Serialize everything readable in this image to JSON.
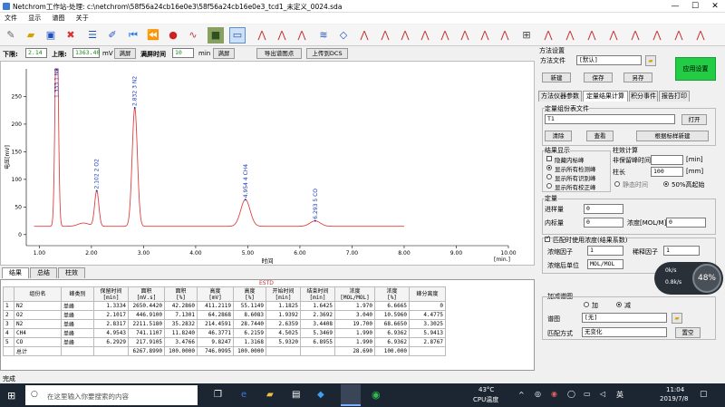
{
  "window": {
    "title": "Netchrom工作站-处理: c:\\netchrom\\58f56a24cb16e0e3\\58f56a24cb16e0e3_tcd1_未定义_0024.sda",
    "min": "—",
    "max": "☐",
    "close": "✕"
  },
  "menu": [
    "文件",
    "显示",
    "谱图",
    "关于"
  ],
  "controls": {
    "lower_label": "下限:",
    "lower_value": "2.14",
    "upper_label": "上限:",
    "upper_value": "1363.40",
    "unit_mv": "mV",
    "fullscreen_btn": "满屏",
    "fullscreen_time_label": "满屏时间",
    "fullscreen_time_value": "10",
    "unit_min": "min",
    "fullscreen_btn2": "满屏",
    "export_btn": "导出谱图点",
    "upload_btn": "上传到DCS"
  },
  "chart_data": {
    "type": "line",
    "title": "",
    "xlabel": "时间",
    "xunit": "[min.]",
    "ylabel": "电压[mV]",
    "xlim": [
      0.75,
      10.0
    ],
    "ylim": [
      -20,
      300
    ],
    "xticks": [
      "1.00",
      "2.00",
      "3.00",
      "4.00",
      "5.00",
      "6.00",
      "7.00",
      "8.00",
      "9.00",
      "10.00"
    ],
    "yticks": [
      "0",
      "50",
      "100",
      "150",
      "200",
      "250"
    ],
    "color": "#e04040",
    "label_color": "#1a38b8",
    "baseline": 15,
    "peaks": [
      {
        "t": 1.3334,
        "h": 411.2119,
        "w": 0.03,
        "label": "1.333 1 N2"
      },
      {
        "t": 2.1017,
        "h": 64.2868,
        "w": 0.04,
        "label": "2.102 2 O2"
      },
      {
        "t": 2.8317,
        "h": 214.4591,
        "w": 0.05,
        "label": "2.832 3 N2"
      },
      {
        "t": 4.9543,
        "h": 48.3771,
        "w": 0.09,
        "label": "4.954 4 CH4"
      },
      {
        "t": 6.2929,
        "h": 9.8247,
        "w": 0.1,
        "label": "6.293 5 CO"
      }
    ]
  },
  "results": {
    "tabs": [
      "结果",
      "总结",
      "柱效"
    ],
    "header_tag": "ESTD",
    "columns": [
      "",
      "组份名",
      "峰类别",
      "保留时间\n[min]",
      "面积\n[mV.s]",
      "面积\n[%]",
      "高度\n[mV]",
      "高度\n[%]",
      "开始时间\n[min]",
      "结束时间\n[min]",
      "浓度\n[MOL/MOL]",
      "浓度\n[%]",
      "峰分离度"
    ],
    "rows": [
      [
        "1",
        "N2",
        "单峰",
        "1.3334",
        "2650.4420",
        "42.2860",
        "411.2119",
        "55.1149",
        "1.1825",
        "1.6425",
        "1.970",
        "6.6665",
        "0"
      ],
      [
        "2",
        "O2",
        "单峰",
        "2.1017",
        "446.9100",
        "7.1301",
        "64.2868",
        "8.6083",
        "1.9392",
        "2.3692",
        "3.040",
        "10.5960",
        "4.4775"
      ],
      [
        "3",
        "N2",
        "单峰",
        "2.8317",
        "2211.5180",
        "35.2832",
        "214.4591",
        "28.7440",
        "2.6359",
        "3.4408",
        "19.700",
        "68.6650",
        "3.3025"
      ],
      [
        "4",
        "CH4",
        "单峰",
        "4.9543",
        "741.1107",
        "11.8240",
        "46.3771",
        "6.2159",
        "4.5025",
        "5.3469",
        "1.990",
        "6.9362",
        "5.9413"
      ],
      [
        "5",
        "CO",
        "单峰",
        "6.2929",
        "217.9105",
        "3.4766",
        "9.8247",
        "1.3168",
        "5.9320",
        "6.8955",
        "1.990",
        "6.9362",
        "2.8767"
      ],
      [
        "",
        "总计",
        "",
        "",
        "6267.8990",
        "100.0000",
        "746.0995",
        "100.0000",
        "",
        "",
        "28.690",
        "100.000",
        ""
      ]
    ]
  },
  "right": {
    "method_settings": "方法设置",
    "method_file_label": "方法文件",
    "method_file_value": "[默认]",
    "new_btn": "新建",
    "save_btn": "保存",
    "saveas_btn": "另存",
    "apply_btn": "应用设置",
    "tabs": [
      "方法仪器参数",
      "定量结果计算",
      "积分事件",
      "报告打印"
    ],
    "quant_group": "定量组份表文件",
    "quant_file": "T1",
    "open_btn": "打开",
    "clear_btn": "清除",
    "view_btn": "查看",
    "build_btn": "根据标样新建",
    "display_group": "结果显示",
    "display_opts": [
      "隐藏内标峰",
      "显示所有检测峰",
      "显示所有识别峰",
      "显示所有校正峰"
    ],
    "display_checked": [
      false,
      true,
      false,
      false
    ],
    "column_group": "柱效计算",
    "noninterval_label": "非保留峰时间",
    "noninterval_unit": "[min]",
    "col_len_label": "柱长",
    "col_len_value": "100",
    "col_len_unit": "[mm]",
    "static_time": "静态时间",
    "half_peak": "50%高起始",
    "qty_group": "定量",
    "sample_label": "进样量",
    "sample_value": "0",
    "istd_label": "内标量",
    "istd_value": "0",
    "conc_label": "浓度[MOL/M]",
    "conc_value": "0",
    "factor_check": "匹配时使用浓度(结果系数)",
    "conc_factor_label": "浓缩因子",
    "conc_factor_value": "1",
    "dilute_label": "稀释因子",
    "dilute_value": "1",
    "conc_unit_label": "浓缩后单位",
    "conc_unit_value": "MOL/MOL",
    "overlay_label": "加减谱图",
    "add_label": "加",
    "sub_label": "减",
    "spectrum_label": "谱图",
    "spectrum_value": "[无]",
    "match_label": "匹配方式",
    "match_value": "无变化",
    "reset_btn": "置空"
  },
  "perf": {
    "percent": "48%",
    "up": "0k/s",
    "down": "0.8k/s"
  },
  "status": "完成",
  "taskbar": {
    "search_placeholder": "在这里输入你要搜索的内容",
    "temp": "43°C",
    "cpu": "CPU温度",
    "time": "11:04",
    "date": "2019/7/8",
    "ime": "英"
  }
}
